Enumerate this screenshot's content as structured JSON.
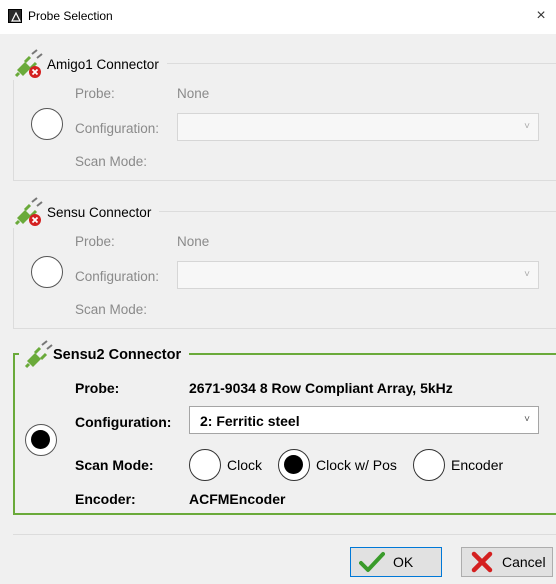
{
  "window": {
    "title": "Probe Selection",
    "close_glyph": "×"
  },
  "connectors": [
    {
      "title": "Amigo1 Connector",
      "icon": "plug-disconnected-icon",
      "probe_label": "Probe:",
      "probe_value": "None",
      "config_label": "Configuration:",
      "config_value": "",
      "scan_label": "Scan Mode:",
      "selected": false
    },
    {
      "title": "Sensu Connector",
      "icon": "plug-disconnected-icon",
      "probe_label": "Probe:",
      "probe_value": "None",
      "config_label": "Configuration:",
      "config_value": "",
      "scan_label": "Scan Mode:",
      "selected": false
    },
    {
      "title": "Sensu2 Connector",
      "icon": "plug-connected-icon",
      "probe_label": "Probe:",
      "probe_value": "2671-9034 8 Row Compliant Array, 5kHz",
      "config_label": "Configuration:",
      "config_value": "2: Ferritic steel",
      "scan_label": "Scan Mode:",
      "scan_options": [
        "Clock",
        "Clock w/ Pos",
        "Encoder"
      ],
      "scan_selected": "Clock w/ Pos",
      "encoder_label": "Encoder:",
      "encoder_value": "ACFMEncoder",
      "selected": true
    }
  ],
  "buttons": {
    "ok": "OK",
    "cancel": "Cancel"
  },
  "colors": {
    "active_border": "#6aaa3a",
    "ok_check": "#3a9b2b",
    "cancel_x": "#d42020"
  }
}
